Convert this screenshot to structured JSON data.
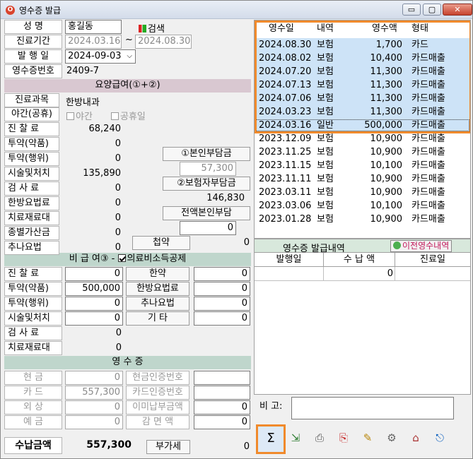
{
  "window": {
    "title": "영수증 발급",
    "min": "▭",
    "max": "▢",
    "close": "✕",
    "app_icon": "O"
  },
  "patient": {
    "name_label": "성    명",
    "name": "홍길동",
    "search": "검색",
    "period_label": "진료기간",
    "period_from": "2024.03.16",
    "period_sep": "~",
    "period_to": "2024.08.30",
    "issue_label": "발 행 일",
    "issue_date": "2024-09-03",
    "receipt_no_label": "영수증번호",
    "receipt_no": "2409-7"
  },
  "insured": {
    "header": "요양급여(①+②)",
    "dept_label": "진료과목",
    "dept": "한방내과",
    "night_label": "야간(공휴)",
    "night_opt": "야간",
    "holiday_opt": "공휴일",
    "rows": [
      {
        "label": "진  찰  료",
        "value": "68,240"
      },
      {
        "label": "투약(약품)",
        "value": "0"
      },
      {
        "label": "투약(행위)",
        "value": "0"
      },
      {
        "label": "시술및처치",
        "value": "135,890"
      },
      {
        "label": "검  사  료",
        "value": "0"
      },
      {
        "label": "한방요법료",
        "value": "0"
      },
      {
        "label": "치료재료대",
        "value": "0"
      },
      {
        "label": "종별가산금",
        "value": "0"
      },
      {
        "label": "추나요법",
        "value": "0"
      }
    ],
    "self_pay_btn": "①본인부담금",
    "self_pay": "57,300",
    "insurer_btn": "②보험자부담금",
    "insurer": "146,830",
    "full_self_btn": "전액본인부담",
    "full_self": "0",
    "herbal_btn": "첩약",
    "herbal": "0"
  },
  "noninsured": {
    "header": "비 급 여③ -",
    "deduct": "의료비소득공제",
    "left": [
      {
        "label": "진  찰  료",
        "value": "0"
      },
      {
        "label": "투약(약품)",
        "value": "500,000"
      },
      {
        "label": "투약(행위)",
        "value": "0"
      },
      {
        "label": "시술및처치",
        "value": "0"
      },
      {
        "label": "검  사  료",
        "value": "0"
      },
      {
        "label": "치료재료대",
        "value": "0"
      }
    ],
    "right": [
      {
        "label": "한약",
        "value": "0"
      },
      {
        "label": "한방요법료",
        "value": "0"
      },
      {
        "label": "추나요법",
        "value": "0"
      },
      {
        "label": "기    타",
        "value": "0"
      }
    ]
  },
  "receipt": {
    "header": "영 수 증",
    "left": [
      {
        "label": "현    금",
        "value": "0"
      },
      {
        "label": "카    드",
        "value": "557,300"
      },
      {
        "label": "외    상",
        "value": "0"
      },
      {
        "label": "예    금",
        "value": "0"
      }
    ],
    "right": [
      {
        "label": "현금인증번호",
        "value": ""
      },
      {
        "label": "카드인증번호",
        "value": ""
      },
      {
        "label": "이미납부금액",
        "value": "0"
      },
      {
        "label": "감  면  액",
        "value": "0"
      }
    ]
  },
  "total": {
    "label": "수납금액",
    "value": "557,300",
    "vat_btn": "부가세",
    "vat": "0"
  },
  "receipts_table": {
    "headers": [
      "영수일",
      "내역",
      "영수액",
      "형태"
    ],
    "rows": [
      [
        "2024.08.30",
        "보험",
        "1,700",
        "카드"
      ],
      [
        "2024.08.02",
        "보험",
        "10,400",
        "카드매출"
      ],
      [
        "2024.07.20",
        "보험",
        "11,300",
        "카드매출"
      ],
      [
        "2024.07.13",
        "보험",
        "11,300",
        "카드매출"
      ],
      [
        "2024.07.06",
        "보험",
        "11,300",
        "카드매출"
      ],
      [
        "2024.03.23",
        "보험",
        "11,300",
        "카드매출"
      ],
      [
        "2024.03.16",
        "일반",
        "500,000",
        "카드매출"
      ],
      [
        "2023.12.09",
        "보험",
        "10,900",
        "카드매출"
      ],
      [
        "2023.11.25",
        "보험",
        "10,900",
        "카드매출"
      ],
      [
        "2023.11.15",
        "보험",
        "10,100",
        "카드매출"
      ],
      [
        "2023.11.11",
        "보험",
        "10,900",
        "카드매출"
      ],
      [
        "2023.03.11",
        "보험",
        "10,900",
        "카드매출"
      ],
      [
        "2023.03.06",
        "보험",
        "10,100",
        "카드매출"
      ],
      [
        "2023.01.28",
        "보험",
        "10,900",
        "카드매출"
      ]
    ]
  },
  "issue_history": {
    "title": "영수증 발급내역",
    "prev_btn": "이전영수내역",
    "headers": [
      "발행일",
      "수 납 액",
      "진료일"
    ],
    "row": [
      "",
      "0",
      ""
    ]
  },
  "remark_label": "비  고:",
  "toolbar": {
    "sum": "Σ",
    "icons": [
      "export-icon",
      "print-icon",
      "print-preview-icon",
      "edit-icon",
      "settings-icon",
      "lock-icon",
      "exit-icon"
    ]
  },
  "colors": {
    "highlight": "#f08a2c",
    "selected_row": "#cde3f7",
    "section_header": "#d9c8d1",
    "section_header2": "#bfd6cc"
  }
}
